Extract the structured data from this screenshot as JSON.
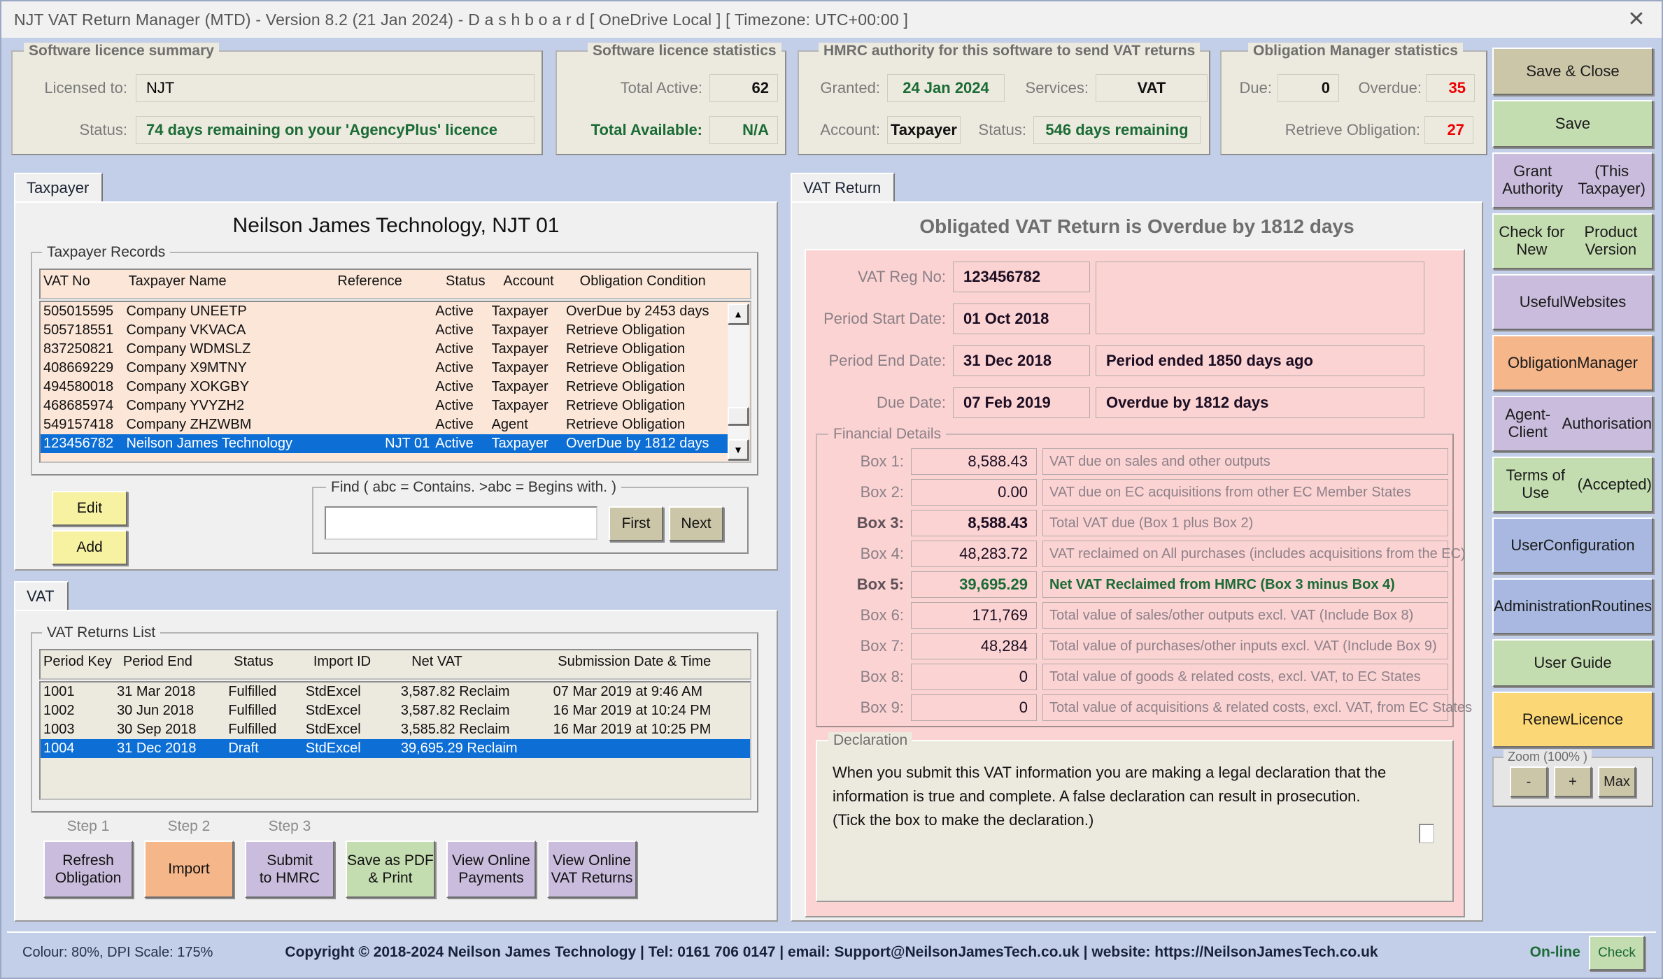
{
  "window": {
    "title": "NJT VAT Return Manager (MTD) - Version 8.2 (21 Jan 2024)  -   D a s h b o a r d   [ OneDrive Local ]   [ Timezone: UTC+00:00 ]",
    "close_icon": "close-icon"
  },
  "licence_summary": {
    "title": "Software licence summary",
    "licensed_to_label": "Licensed to:",
    "licensed_to_value": "NJT",
    "status_label": "Status:",
    "status_value": "74 days remaining on your 'AgencyPlus' licence"
  },
  "licence_stats": {
    "title": "Software licence statistics",
    "total_active_label": "Total Active:",
    "total_active_value": "62",
    "total_available_label": "Total Available:",
    "total_available_value": "N/A"
  },
  "hmrc_authority": {
    "title": "HMRC authority for this software to send VAT returns",
    "granted_label": "Granted:",
    "granted_value": "24 Jan 2024",
    "services_label": "Services:",
    "services_value": "VAT",
    "account_label": "Account:",
    "account_value": "Taxpayer",
    "status_label": "Status:",
    "status_value": "546 days remaining"
  },
  "obligation_stats": {
    "title": "Obligation Manager statistics",
    "due_label": "Due:",
    "due_value": "0",
    "overdue_label": "Overdue:",
    "overdue_value": "35",
    "retrieve_label": "Retrieve Obligation:",
    "retrieve_value": "27"
  },
  "sidebar": {
    "buttons": [
      {
        "label": "Save & Close",
        "color": "c-khaki"
      },
      {
        "label": "Save",
        "color": "c-green"
      },
      {
        "label": "Grant Authority\n(This Taxpayer)",
        "color": "c-purple"
      },
      {
        "label": "Check for New\nProduct Version",
        "color": "c-green"
      },
      {
        "label": "Useful\nWebsites",
        "color": "c-purple"
      },
      {
        "label": "Obligation\nManager",
        "color": "c-orange"
      },
      {
        "label": "Agent-Client\nAuthorisation",
        "color": "c-purple"
      },
      {
        "label": "Terms of Use\n(Accepted)",
        "color": "c-green"
      },
      {
        "label": "User\nConfiguration",
        "color": "c-blue"
      },
      {
        "label": "Administration\nRoutines",
        "color": "c-blue"
      },
      {
        "label": "User Guide",
        "color": "c-green"
      },
      {
        "label": "Renew\nLicence",
        "color": "c-yellow"
      }
    ],
    "zoom": {
      "title": "Zoom (100% )",
      "minus": "-",
      "plus": "+",
      "max": "Max"
    }
  },
  "taxpayer_panel": {
    "tab_label": "Taxpayer",
    "heading": "Neilson James Technology, NJT 01",
    "records_group_title": "Taxpayer Records",
    "columns": [
      "VAT No",
      "Taxpayer Name",
      "Reference",
      "Status",
      "Account",
      "Obligation Condition"
    ],
    "rows": [
      {
        "vat_no": "505015595",
        "name": "Company UNEETP",
        "reference": "",
        "status": "Active",
        "account": "Taxpayer",
        "condition": "OverDue by 2453 days",
        "selected": false
      },
      {
        "vat_no": "505718551",
        "name": "Company VKVACA",
        "reference": "",
        "status": "Active",
        "account": "Taxpayer",
        "condition": "Retrieve Obligation",
        "selected": false
      },
      {
        "vat_no": "837250821",
        "name": "Company WDMSLZ",
        "reference": "",
        "status": "Active",
        "account": "Taxpayer",
        "condition": "Retrieve Obligation",
        "selected": false
      },
      {
        "vat_no": "408669229",
        "name": "Company X9MTNY",
        "reference": "",
        "status": "Active",
        "account": "Taxpayer",
        "condition": "Retrieve Obligation",
        "selected": false
      },
      {
        "vat_no": "494580018",
        "name": "Company XOKGBY",
        "reference": "",
        "status": "Active",
        "account": "Taxpayer",
        "condition": "Retrieve Obligation",
        "selected": false
      },
      {
        "vat_no": "468685974",
        "name": "Company YVYZH2",
        "reference": "",
        "status": "Active",
        "account": "Taxpayer",
        "condition": "Retrieve Obligation",
        "selected": false
      },
      {
        "vat_no": "549157418",
        "name": "Company ZHZWBM",
        "reference": "",
        "status": "Active",
        "account": "Agent",
        "condition": "Retrieve Obligation",
        "selected": false
      },
      {
        "vat_no": "123456782",
        "name": "Neilson James Technology",
        "reference": "NJT 01",
        "status": "Active",
        "account": "Taxpayer",
        "condition": "OverDue by 1812 days",
        "selected": true
      }
    ],
    "edit_label": "Edit",
    "add_label": "Add",
    "find_title": "Find ( abc = Contains.  >abc = Begins with. )",
    "find_value": "",
    "find_placeholder": "",
    "first_label": "First",
    "next_label": "Next"
  },
  "vat_panel": {
    "tab_label": "VAT",
    "group_title": "VAT Returns List",
    "columns": [
      "Period Key",
      "Period End",
      "Status",
      "Import ID",
      "Net VAT",
      "Submission Date & Time"
    ],
    "rows": [
      {
        "period_key": "1001",
        "period_end": "31 Mar 2018",
        "status": "Fulfilled",
        "import_id": "StdExcel",
        "net_vat": "3,587.82 Reclaim",
        "submission": "07 Mar 2019 at 9:46 AM",
        "selected": false
      },
      {
        "period_key": "1002",
        "period_end": "30 Jun 2018",
        "status": "Fulfilled",
        "import_id": "StdExcel",
        "net_vat": "3,587.82 Reclaim",
        "submission": "16 Mar 2019 at 10:24 PM",
        "selected": false
      },
      {
        "period_key": "1003",
        "period_end": "30 Sep 2018",
        "status": "Fulfilled",
        "import_id": "StdExcel",
        "net_vat": "3,585.82 Reclaim",
        "submission": "16 Mar 2019 at 10:25 PM",
        "selected": false
      },
      {
        "period_key": "1004",
        "period_end": "31 Dec 2018",
        "status": "Draft",
        "import_id": "StdExcel",
        "net_vat": "39,695.29 Reclaim",
        "submission": "",
        "selected": true
      }
    ],
    "steps": [
      {
        "caption": "Step 1",
        "label": "Refresh\nObligation",
        "color": "#c9bcdc"
      },
      {
        "caption": "Step 2",
        "label": "Import",
        "color": "#f5b68a"
      },
      {
        "caption": "Step 3",
        "label": "Submit\nto HMRC",
        "color": "#c9bcdc"
      },
      {
        "caption": "",
        "label": "Save as PDF\n& Print",
        "color": "#c3dcb0"
      },
      {
        "caption": "",
        "label": "View Online\nPayments",
        "color": "#c9bcdc"
      },
      {
        "caption": "",
        "label": "View Online\nVAT Returns",
        "color": "#c9bcdc"
      }
    ]
  },
  "vat_return": {
    "tab_label": "VAT Return",
    "heading": "Obligated VAT Return is Overdue by 1812 days",
    "vat_reg_label": "VAT Reg No:",
    "vat_reg_value": "123456782",
    "period_start_label": "Period Start Date:",
    "period_start_value": "01 Oct 2018",
    "period_end_label": "Period End Date:",
    "period_end_value": "31 Dec 2018",
    "period_end_note": "Period ended 1850 days ago",
    "due_label": "Due Date:",
    "due_value": "07 Feb 2019",
    "due_note": "Overdue by 1812 days",
    "financial_title": "Financial Details",
    "boxes": [
      {
        "label": "Box 1:",
        "value": "8,588.43",
        "desc": "VAT due on sales and other outputs",
        "emphasis": "value-dark"
      },
      {
        "label": "Box 2:",
        "value": "0.00",
        "desc": "VAT due on EC acquisitions from other EC Member States",
        "emphasis": "normal"
      },
      {
        "label": "Box 3:",
        "value": "8,588.43",
        "desc": "Total VAT due (Box 1 plus Box 2)",
        "emphasis": "bold"
      },
      {
        "label": "Box 4:",
        "value": "48,283.72",
        "desc": "VAT reclaimed on All purchases (includes acquisitions from the EC)",
        "emphasis": "normal"
      },
      {
        "label": "Box 5:",
        "value": "39,695.29",
        "desc": "Net VAT Reclaimed from HMRC (Box 3 minus Box 4)",
        "emphasis": "green"
      },
      {
        "label": "Box 6:",
        "value": "171,769",
        "desc": "Total value of sales/other outputs excl. VAT (Include Box 8)",
        "emphasis": "normal"
      },
      {
        "label": "Box 7:",
        "value": "48,284",
        "desc": "Total value of purchases/other inputs excl. VAT (Include Box 9)",
        "emphasis": "normal"
      },
      {
        "label": "Box 8:",
        "value": "0",
        "desc": "Total value of goods & related costs, excl. VAT, to EC States",
        "emphasis": "normal"
      },
      {
        "label": "Box 9:",
        "value": "0",
        "desc": "Total value of acquisitions & related costs, excl. VAT, from EC States",
        "emphasis": "normal"
      }
    ],
    "declaration_title": "Declaration",
    "declaration_line1": "When you submit this VAT information you are making a legal declaration that the",
    "declaration_line2": "information is true and complete. A false declaration can result in prosecution.",
    "declaration_line3": "(Tick the box to make the declaration.)",
    "declaration_checked": false
  },
  "statusbar": {
    "left": "Colour: 80%, DPI Scale: 175%",
    "center": "Copyright © 2018-2024 Neilson James Technology  |  Tel: 0161 706 0147  |  email: Support@NeilsonJamesTech.co.uk  |  website: https://NeilsonJamesTech.co.uk",
    "online": "On-line",
    "check": "Check"
  },
  "colors": {
    "window_bg": "#c3cfe8",
    "panel_bg": "#eceade",
    "grid_pink": "#fbe6d8",
    "selection": "#0d6fd6",
    "green": "#1b6b36",
    "red": "#ee0000",
    "pink_panel": "#fbd3d3"
  }
}
